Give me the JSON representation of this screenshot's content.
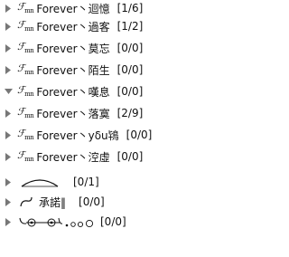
{
  "groups": [
    {
      "prefix": "ℱ",
      "prefix_sub": "mn",
      "name": "Forever丶迴憶",
      "count": "[1/6]",
      "expanded": false
    },
    {
      "prefix": "ℱ",
      "prefix_sub": "mn",
      "name": "Forever丶過客",
      "count": "[1/2]",
      "expanded": false
    },
    {
      "prefix": "ℱ",
      "prefix_sub": "mn",
      "name": "Forever丶莫忘",
      "count": "[0/0]",
      "expanded": false
    },
    {
      "prefix": "ℱ",
      "prefix_sub": "mn",
      "name": "Forever丶陌生",
      "count": "[0/0]",
      "expanded": false
    },
    {
      "prefix": "ℱ",
      "prefix_sub": "mn",
      "name": "Forever丶嘆息",
      "count": "[0/0]",
      "expanded": true
    },
    {
      "prefix": "ℱ",
      "prefix_sub": "mn",
      "name": "Forever丶落寞",
      "count": "[2/9]",
      "expanded": false
    },
    {
      "prefix": "ℱ",
      "prefix_sub": "mn",
      "name": "Forever丶yδu鴇",
      "count": "[0/0]",
      "expanded": false
    },
    {
      "prefix": "ℱ",
      "prefix_sub": "mn",
      "name": "Forever丶涳虛",
      "count": "[0/0]",
      "expanded": false
    },
    {
      "prefix": "",
      "name": "",
      "count": "[0/1]",
      "expanded": false,
      "deco": "arc"
    },
    {
      "prefix": "",
      "name": "承諾‖",
      "count": "[0/0]",
      "expanded": false,
      "deco": "hook"
    },
    {
      "prefix": "",
      "name": "",
      "count": "[0/0]",
      "expanded": false,
      "deco": "beads"
    }
  ],
  "icons": {
    "collapsed": "triangle-right-icon",
    "expanded": "triangle-down-icon"
  },
  "colors": {
    "arrow": "#777777",
    "text": "#111111"
  }
}
